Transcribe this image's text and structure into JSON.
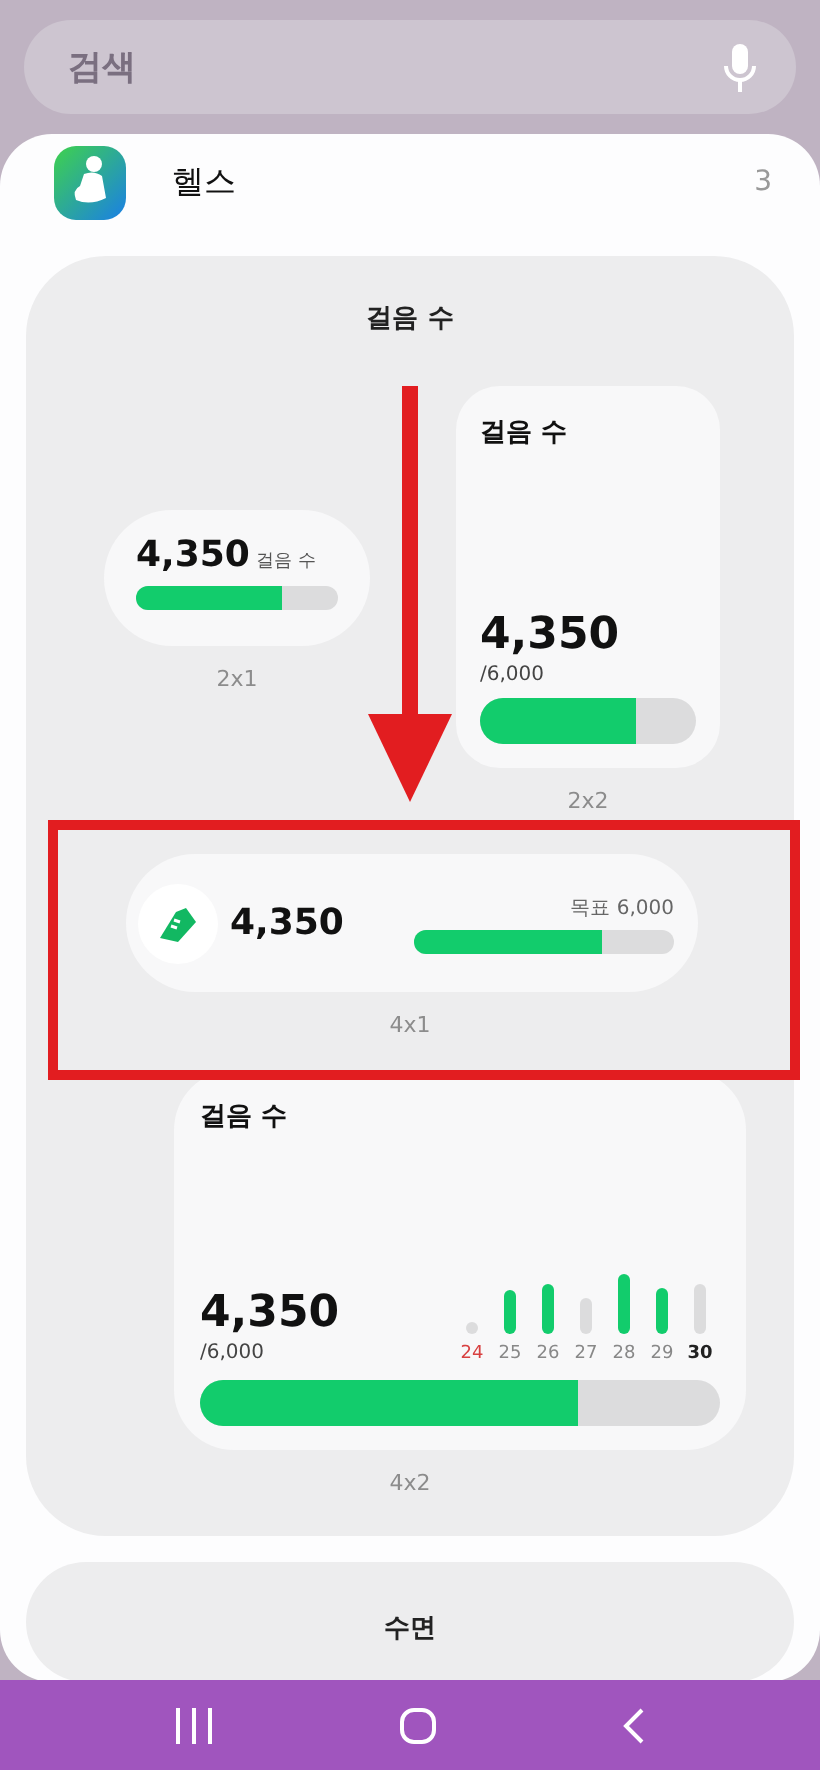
{
  "search": {
    "placeholder": "검색"
  },
  "app_header": {
    "name": "헬스",
    "count": "3"
  },
  "sections": [
    {
      "title": "걸음 수",
      "widgets": [
        {
          "kind": "small",
          "size": "2x1",
          "value": "4,350",
          "unit": "걸음 수",
          "level": 0.725
        },
        {
          "kind": "square",
          "size": "2x2",
          "title": "걸음 수",
          "value": "4,350",
          "goal": "/6,000",
          "level": 0.725
        },
        {
          "kind": "wide",
          "size": "4x1",
          "value": "4,350",
          "goal": "목표 6,000",
          "level": 0.725
        },
        {
          "kind": "large",
          "size": "4x2",
          "title": "걸음 수",
          "value": "4,350",
          "goal": "/6,000",
          "level": 0.725,
          "days": [
            {
              "label": "24",
              "kind": "sunday",
              "achieved": false
            },
            {
              "label": "25",
              "kind": "weekday",
              "achieved": true
            },
            {
              "label": "26",
              "kind": "weekday",
              "achieved": true
            },
            {
              "label": "27",
              "kind": "weekday",
              "achieved": false
            },
            {
              "label": "28",
              "kind": "weekday",
              "achieved": true
            },
            {
              "label": "29",
              "kind": "weekday",
              "achieved": true
            },
            {
              "label": "30",
              "kind": "today",
              "achieved": false
            }
          ]
        }
      ]
    },
    {
      "title": "수면"
    }
  ]
}
